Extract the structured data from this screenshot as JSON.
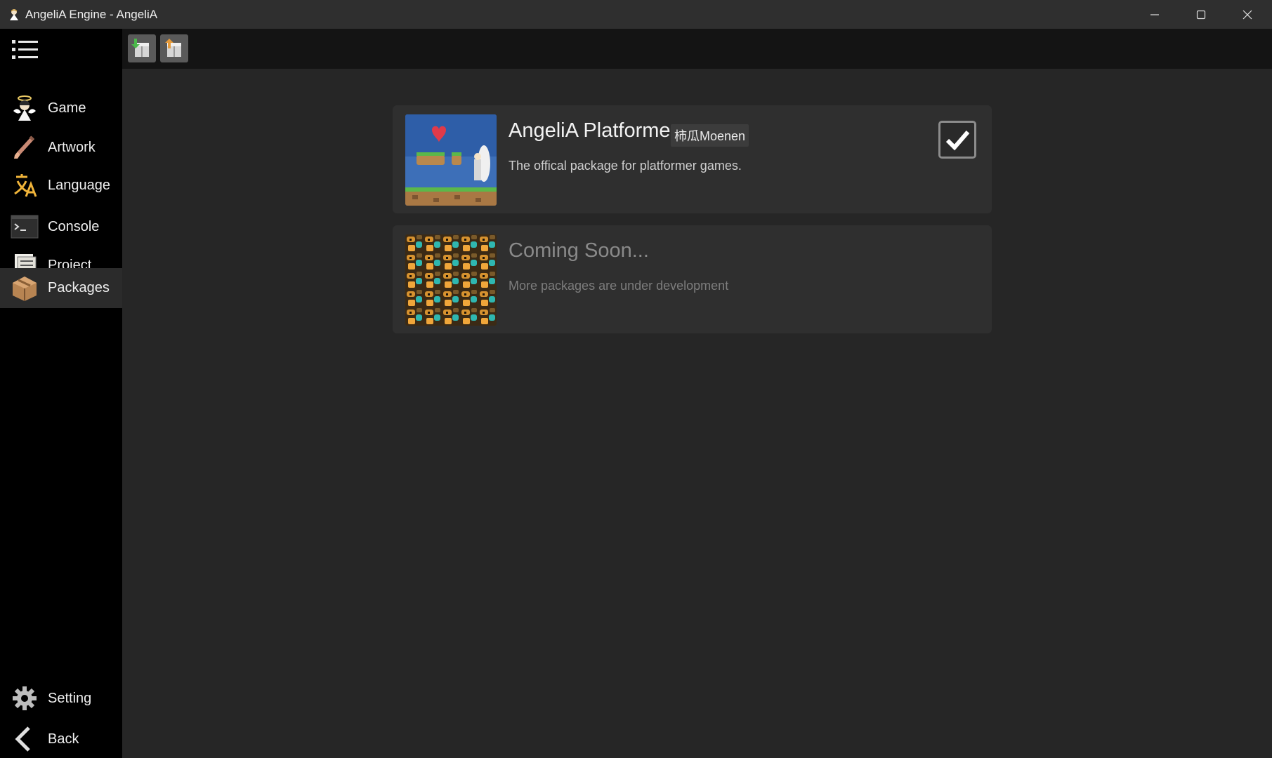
{
  "window": {
    "title": "AngeliA Engine - AngeliA"
  },
  "sidebar": {
    "menu_icon": "hamburger-menu-icon",
    "items": [
      {
        "label": "Game",
        "icon": "angel-character-icon"
      },
      {
        "label": "Artwork",
        "icon": "paintbrush-icon"
      },
      {
        "label": "Language",
        "icon": "language-icon"
      },
      {
        "label": "Console",
        "icon": "terminal-icon"
      },
      {
        "label": "Project",
        "icon": "document-icon"
      },
      {
        "label": "Packages",
        "icon": "package-box-icon"
      }
    ],
    "active": "Packages",
    "bottom_items": [
      {
        "label": "Setting",
        "icon": "gear-icon"
      },
      {
        "label": "Back",
        "icon": "back-arrow-icon"
      }
    ]
  },
  "toolbar": {
    "buttons": [
      {
        "icon": "import-package-icon"
      },
      {
        "icon": "export-package-icon"
      }
    ]
  },
  "packages": [
    {
      "name": "AngeliA Platformer",
      "author": "柿瓜Moenen",
      "description": "The offical package for platformer games.",
      "installed": true
    },
    {
      "name": "Coming Soon...",
      "description": "More packages are under development"
    }
  ],
  "colors": {
    "sidebar_bg": "#000000",
    "main_bg": "#262626",
    "card_bg": "#2f2f2f",
    "titlebar_bg": "#2f2f2f",
    "active_item_bg": "#2b2b2b"
  }
}
